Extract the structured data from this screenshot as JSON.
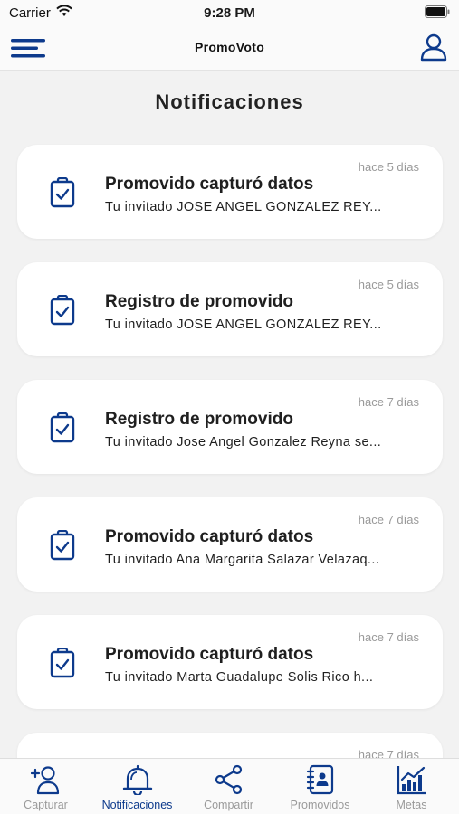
{
  "status_bar": {
    "carrier": "Carrier",
    "time": "9:28 PM"
  },
  "header": {
    "title": "PromoVoto"
  },
  "page": {
    "title": "Notificaciones"
  },
  "notifications": [
    {
      "time": "hace 5 días",
      "title": "Promovido capturó datos",
      "body": "Tu invitado JOSE ANGEL GONZALEZ REY..."
    },
    {
      "time": "hace 5 días",
      "title": "Registro de promovido",
      "body": "Tu invitado JOSE ANGEL GONZALEZ REY..."
    },
    {
      "time": "hace 7 días",
      "title": "Registro de promovido",
      "body": "Tu invitado Jose Angel Gonzalez Reyna se..."
    },
    {
      "time": "hace 7 días",
      "title": "Promovido capturó datos",
      "body": "Tu invitado Ana Margarita Salazar Velazaq..."
    },
    {
      "time": "hace 7 días",
      "title": "Promovido capturó datos",
      "body": "Tu invitado Marta Guadalupe Solis Rico h..."
    },
    {
      "time": "hace 7 días",
      "title": "",
      "body": ""
    }
  ],
  "tabs": [
    {
      "label": "Capturar",
      "icon": "add-user-icon"
    },
    {
      "label": "Notificaciones",
      "icon": "bell-icon",
      "active": true
    },
    {
      "label": "Compartir",
      "icon": "share-icon"
    },
    {
      "label": "Promovidos",
      "icon": "contacts-book-icon"
    },
    {
      "label": "Metas",
      "icon": "bar-chart-icon"
    }
  ],
  "colors": {
    "accent": "#0d3a8c",
    "inactive": "#9a9a9a",
    "background": "#f2f2f2"
  }
}
